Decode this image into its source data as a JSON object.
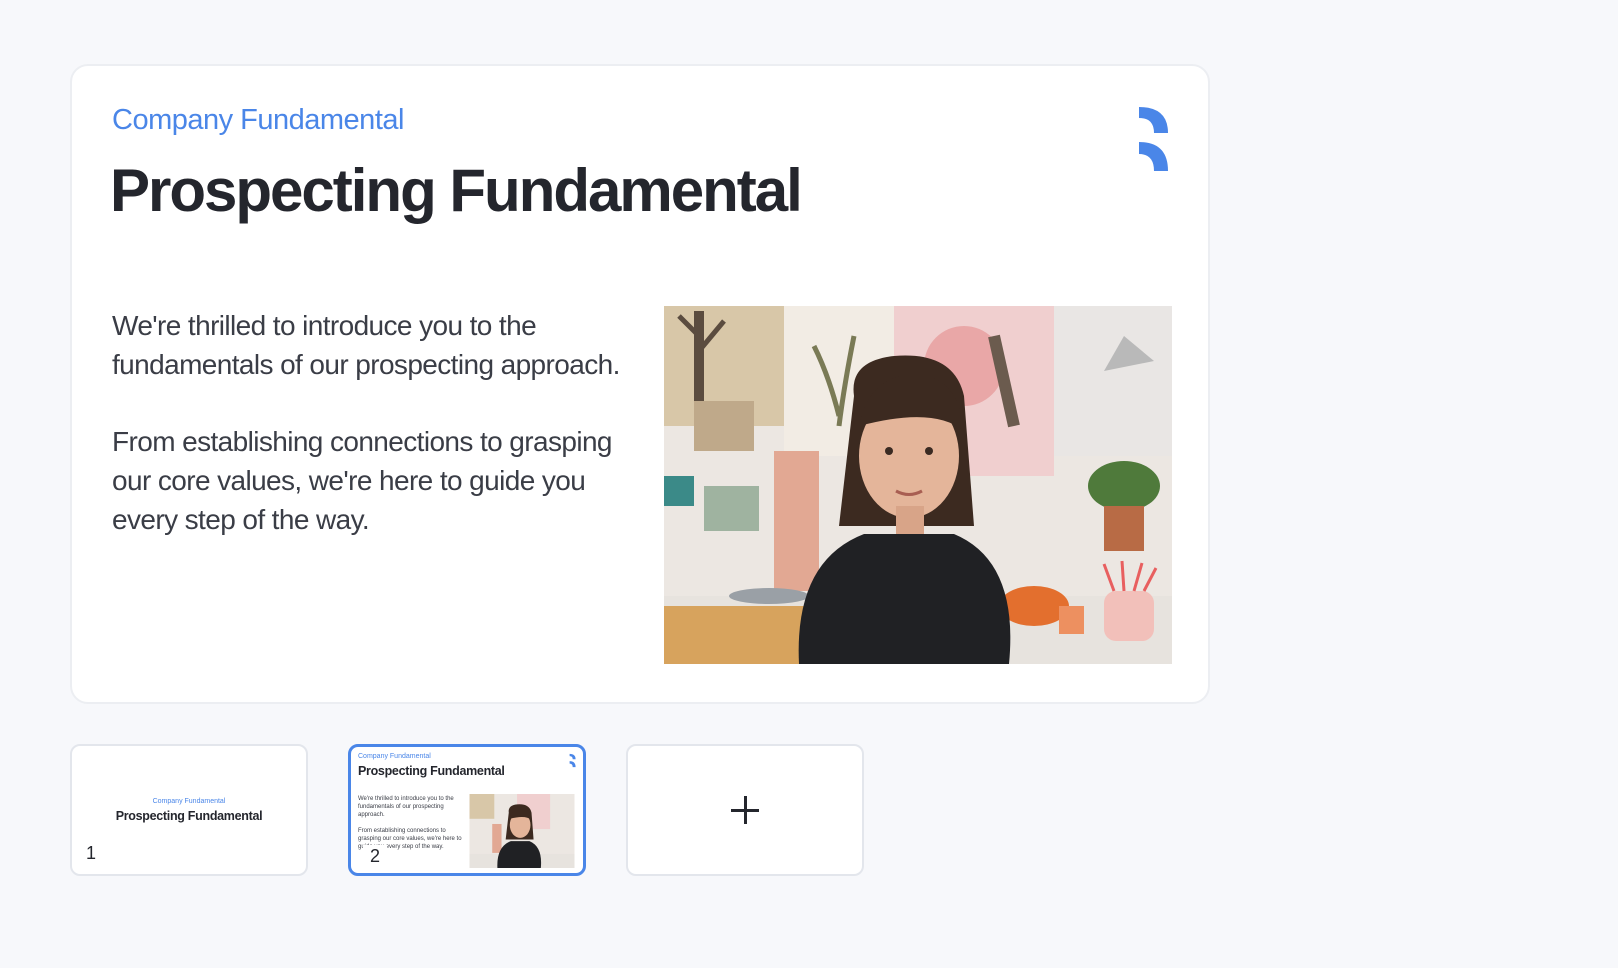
{
  "slide": {
    "kicker": "Company Fundamental",
    "title": "Prospecting Fundamental",
    "paragraphs": [
      "We're thrilled to introduce you to the fundamentals of our prospecting approach.",
      "From establishing connections to grasping our core values, we're here to guide you every step of the way."
    ],
    "logo_icon": "brand-bracket-icon",
    "photo": "portrait-woman-art-studio-photo"
  },
  "thumbnails": [
    {
      "number": "1",
      "kicker": "Company Fundamental",
      "title": "Prospecting Fundamental"
    },
    {
      "number": "2",
      "kicker": "Company Fundamental",
      "title": "Prospecting Fundamental",
      "paragraphs": [
        "We're thrilled to introduce you to the fundamentals of our prospecting approach.",
        "From establishing connections to grasping our core values, we're here to guide you every step of the way."
      ],
      "active": true
    }
  ],
  "add_slide": {
    "icon": "plus-icon"
  },
  "colors": {
    "accent": "#4a86e8",
    "background": "#f7f8fb",
    "text": "#24262d"
  }
}
